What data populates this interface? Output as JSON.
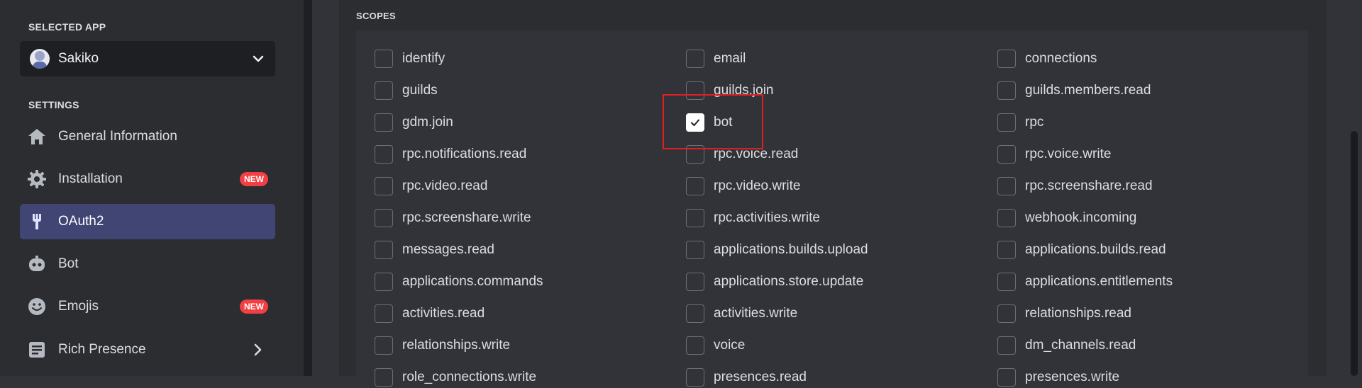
{
  "sidebar": {
    "selected_app_label": "SELECTED APP",
    "app_name": "Sakiko",
    "settings_label": "SETTINGS",
    "items": [
      {
        "label": "General Information",
        "icon": "home-icon"
      },
      {
        "label": "Installation",
        "icon": "gear-icon",
        "badge": "NEW"
      },
      {
        "label": "OAuth2",
        "icon": "wrench-icon",
        "active": true
      },
      {
        "label": "Bot",
        "icon": "robot-icon"
      },
      {
        "label": "Emojis",
        "icon": "smile-icon",
        "badge": "NEW"
      },
      {
        "label": "Rich Presence",
        "icon": "document-icon"
      }
    ]
  },
  "scopes": {
    "title": "SCOPES",
    "rows": [
      [
        "identify",
        "email",
        "connections"
      ],
      [
        "guilds",
        "guilds.join",
        "guilds.members.read"
      ],
      [
        "gdm.join",
        "bot",
        "rpc"
      ],
      [
        "rpc.notifications.read",
        "rpc.voice.read",
        "rpc.voice.write"
      ],
      [
        "rpc.video.read",
        "rpc.video.write",
        "rpc.screenshare.read"
      ],
      [
        "rpc.screenshare.write",
        "rpc.activities.write",
        "webhook.incoming"
      ],
      [
        "messages.read",
        "applications.builds.upload",
        "applications.builds.read"
      ],
      [
        "applications.commands",
        "applications.store.update",
        "applications.entitlements"
      ],
      [
        "activities.read",
        "activities.write",
        "relationships.read"
      ],
      [
        "relationships.write",
        "voice",
        "dm_channels.read"
      ],
      [
        "role_connections.write",
        "presences.read",
        "presences.write"
      ]
    ],
    "checked": [
      "bot"
    ]
  },
  "colors": {
    "accent": "#404573",
    "badge": "#f23f43",
    "highlight": "#e02020"
  }
}
